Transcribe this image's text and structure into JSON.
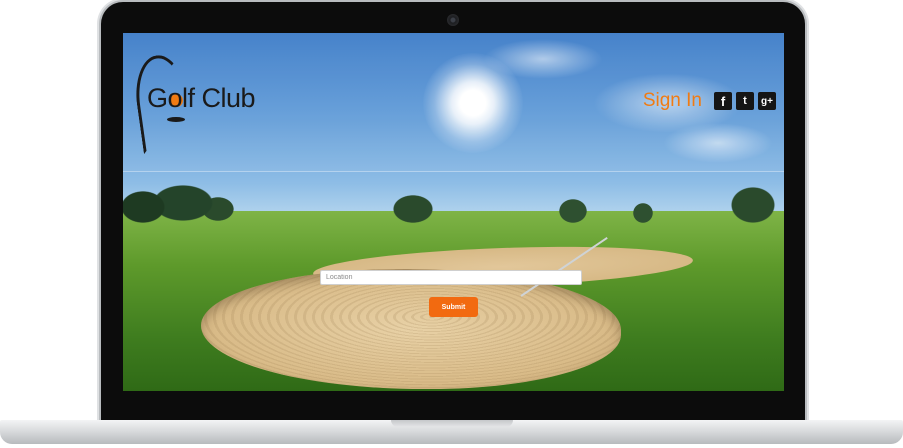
{
  "brand": {
    "logo_text": "Golf Club",
    "logo_accent_color": "#f07b13"
  },
  "header": {
    "sign_in_label": "Sign In",
    "social": [
      {
        "name": "facebook",
        "glyph": "f"
      },
      {
        "name": "twitter",
        "glyph": "t"
      },
      {
        "name": "google-plus",
        "glyph": "g+"
      }
    ]
  },
  "search": {
    "placeholder": "Location",
    "value": "",
    "submit_label": "Submit"
  },
  "colors": {
    "accent": "#f26a10",
    "social_bg": "#151515"
  }
}
